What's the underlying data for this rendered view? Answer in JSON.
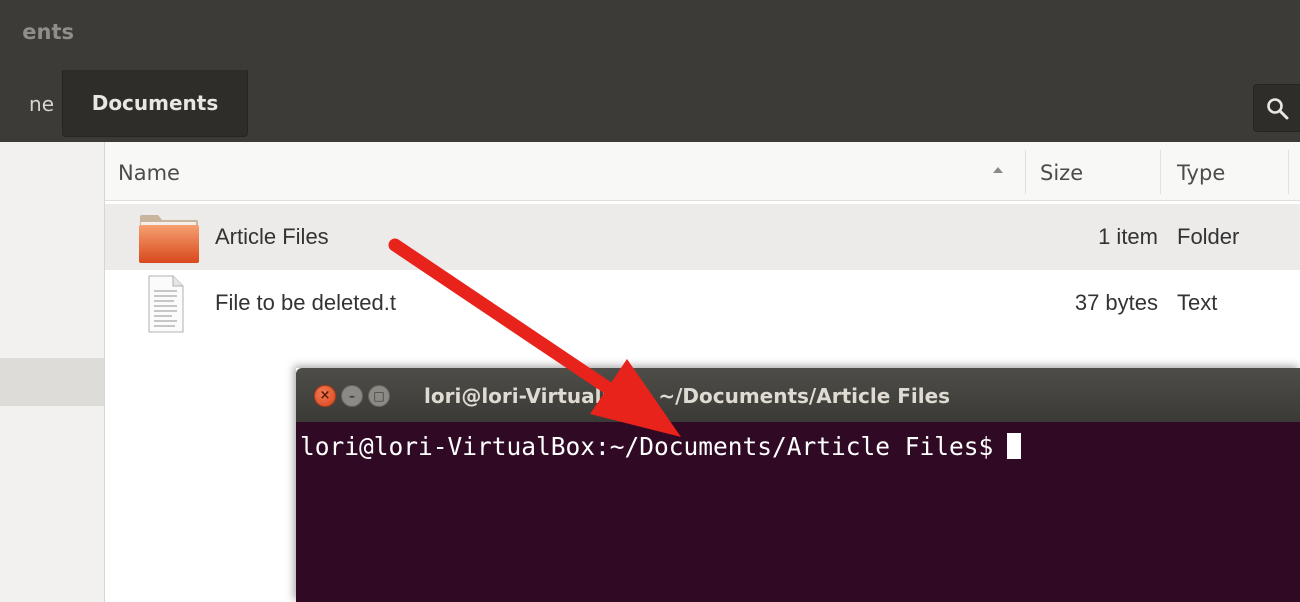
{
  "window": {
    "title": "ents"
  },
  "pathbar": {
    "home_label": "ne",
    "current": "Documents"
  },
  "columns": {
    "name": "Name",
    "size": "Size",
    "type": "Type"
  },
  "files": [
    {
      "name": "Article Files",
      "size": "1 item",
      "type": "Folder",
      "icon": "folder-icon"
    },
    {
      "name": "File to be deleted.t",
      "size": "37 bytes",
      "type": "Text",
      "icon": "text-file-icon"
    }
  ],
  "terminal": {
    "title": "lori@lori-VirtualBox: ~/Documents/Article Files",
    "prompt": "lori@lori-VirtualBox:~/Documents/Article Files$"
  },
  "annotation": {
    "arrow_color": "#e8231c"
  }
}
